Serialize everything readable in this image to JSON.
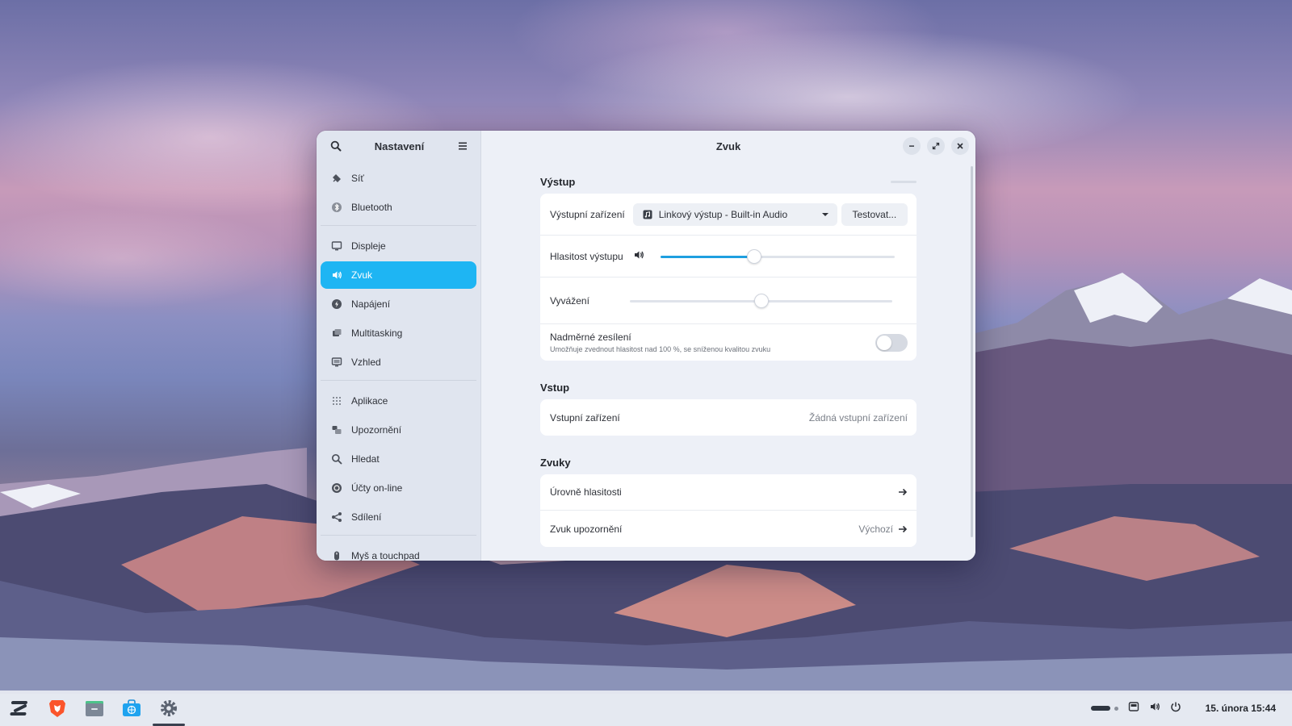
{
  "window": {
    "sidebar_title": "Nastavení",
    "main_title": "Zvuk"
  },
  "sidebar": {
    "items": [
      {
        "label": "Síť",
        "icon": "network-icon"
      },
      {
        "label": "Bluetooth",
        "icon": "bluetooth-icon"
      },
      {
        "label": "Displeje",
        "icon": "display-icon"
      },
      {
        "label": "Zvuk",
        "icon": "speaker-icon",
        "active": true
      },
      {
        "label": "Napájení",
        "icon": "power-icon"
      },
      {
        "label": "Multitasking",
        "icon": "multitasking-icon"
      },
      {
        "label": "Vzhled",
        "icon": "appearance-icon"
      },
      {
        "label": "Aplikace",
        "icon": "apps-grid-icon"
      },
      {
        "label": "Upozornění",
        "icon": "notifications-icon"
      },
      {
        "label": "Hledat",
        "icon": "search-icon"
      },
      {
        "label": "Účty on-line",
        "icon": "online-accounts-icon"
      },
      {
        "label": "Sdílení",
        "icon": "share-icon"
      },
      {
        "label": "Myš a touchpad",
        "icon": "mouse-icon"
      }
    ]
  },
  "output": {
    "title": "Výstup",
    "device_label": "Výstupní zařízení",
    "device_value": "Linkový výstup - Built-in Audio",
    "test_button": "Testovat...",
    "volume_label": "Hlasitost výstupu",
    "volume_level": 0.4,
    "balance_label": "Vyvážení",
    "balance_level": 0.5,
    "overamp_label": "Nadměrné zesílení",
    "overamp_desc": "Umožňuje zvednout hlasitost nad 100 %, se sníženou kvalitou zvuku",
    "overamp_enabled": false
  },
  "input": {
    "title": "Vstup",
    "device_label": "Vstupní zařízení",
    "device_value": "Žádná vstupní zařízení"
  },
  "sounds": {
    "title": "Zvuky",
    "levels_label": "Úrovně hlasitosti",
    "alert_label": "Zvuk upozornění",
    "alert_value": "Výchozí"
  },
  "taskbar": {
    "apps": [
      "zorin-menu-icon",
      "brave-browser-icon",
      "files-icon",
      "software-store-icon",
      "settings-gear-icon"
    ],
    "clock": "15. února  15:44"
  },
  "colors": {
    "accent": "#1eb5f3",
    "slider_fill": "#1e9fe0"
  }
}
